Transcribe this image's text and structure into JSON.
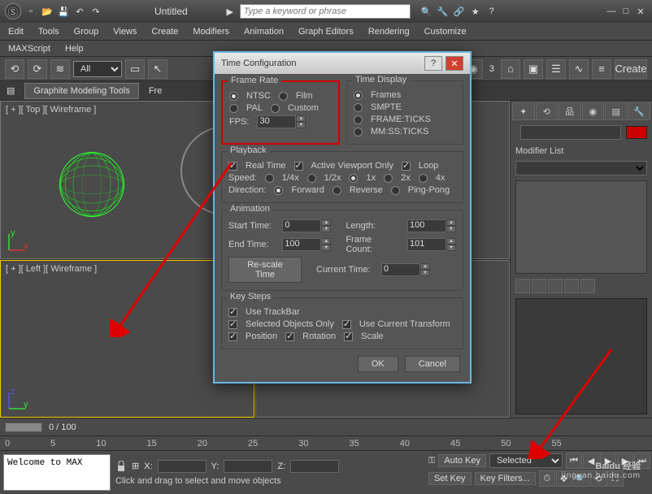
{
  "title": "Untitled",
  "search_placeholder": "Type a keyword or phrase",
  "menus": [
    "Edit",
    "Tools",
    "Group",
    "Views",
    "Create",
    "Modifiers",
    "Animation",
    "Graph Editors",
    "Rendering",
    "Customize"
  ],
  "menus2": [
    "MAXScript",
    "Help"
  ],
  "selector_dropdown": "All",
  "ribbon_tab": "Graphite Modeling Tools",
  "ribbon_extra": "Fre",
  "toolbar_right_create": "Create",
  "viewports": {
    "top": "[ + ][ Top ][ Wireframe ]",
    "left": "[ + ][ Left ][ Wireframe ]"
  },
  "cmdpanel": {
    "modifier_list": "Modifier List"
  },
  "timeline": {
    "range": "0 / 100"
  },
  "ruler_ticks": [
    "0",
    "5",
    "10",
    "15",
    "20",
    "25",
    "30",
    "35",
    "40",
    "45",
    "50",
    "55"
  ],
  "status": {
    "welcome": "Welcome to MAX",
    "hint": "Click and drag to select and move objects",
    "coords": {
      "x": "X:",
      "y": "Y:",
      "z": "Z:"
    },
    "autokey": "Auto Key",
    "setkey": "Set Key",
    "selected": "Selected",
    "keyfilters": "Key Filters..."
  },
  "dialog": {
    "title": "Time Configuration",
    "frame_rate": {
      "legend": "Frame Rate",
      "ntsc": "NTSC",
      "film": "Film",
      "pal": "PAL",
      "custom": "Custom",
      "fps_label": "FPS:",
      "fps_value": "30"
    },
    "time_display": {
      "legend": "Time Display",
      "frames": "Frames",
      "smpte": "SMPTE",
      "frame_ticks": "FRAME:TICKS",
      "mmss": "MM:SS:TICKS"
    },
    "playback": {
      "legend": "Playback",
      "realtime": "Real Time",
      "avo": "Active Viewport Only",
      "loop": "Loop",
      "speed": "Speed:",
      "s1": "1/4x",
      "s2": "1/2x",
      "s3": "1x",
      "s4": "2x",
      "s5": "4x",
      "direction": "Direction:",
      "d1": "Forward",
      "d2": "Reverse",
      "d3": "Ping-Pong"
    },
    "animation": {
      "legend": "Animation",
      "start": "Start Time:",
      "start_v": "0",
      "end": "End Time:",
      "end_v": "100",
      "length": "Length:",
      "length_v": "100",
      "frame_count": "Frame Count:",
      "frame_count_v": "101",
      "rescale": "Re-scale Time",
      "current": "Current Time:",
      "current_v": "0"
    },
    "keysteps": {
      "legend": "Key Steps",
      "trackbar": "Use TrackBar",
      "selected_only": "Selected Objects Only",
      "use_current": "Use Current Transform",
      "position": "Position",
      "rotation": "Rotation",
      "scale": "Scale"
    },
    "ok": "OK",
    "cancel": "Cancel"
  },
  "watermark": {
    "brand": "Baidu 经验",
    "url": "jingyan.baidu.com"
  }
}
